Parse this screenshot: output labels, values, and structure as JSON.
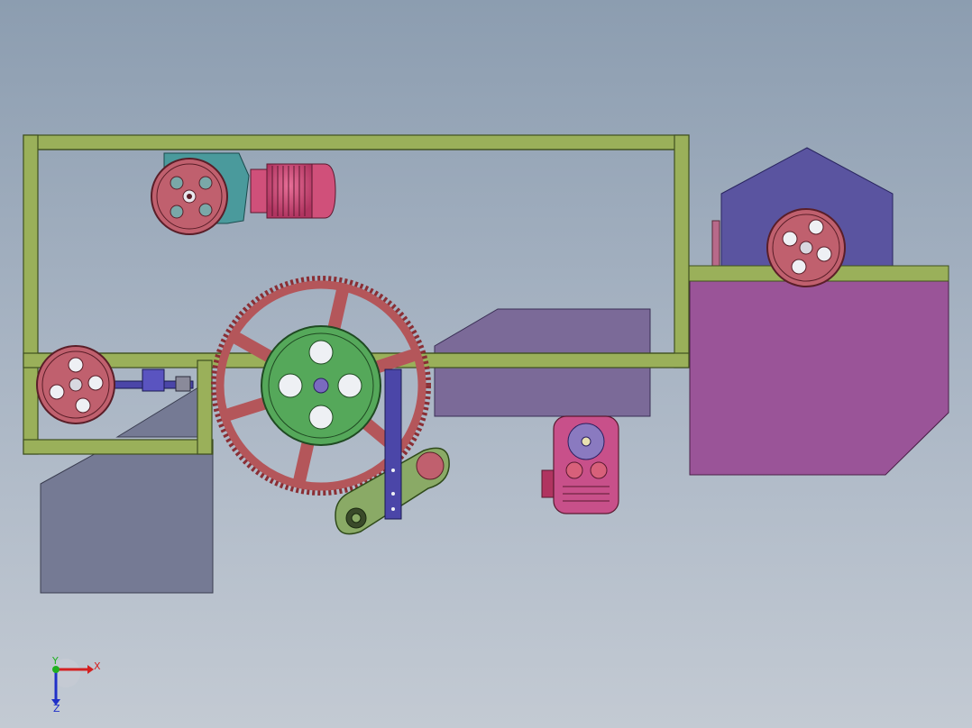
{
  "viewport": {
    "background_top": "#8c9db0",
    "background_bottom": "#c3cad3"
  },
  "colors": {
    "frame": "#9ab05a",
    "frame_edge": "#3f4f1f",
    "pulley": "#c0606e",
    "pulley_edge": "#5a1e28",
    "gear_wheel": "#b4565a",
    "drive_wheel": "#55a85a",
    "motor": "#d0507a",
    "gearbox": "#4a9a9c",
    "hopper": "#5a54a0",
    "table": "#9a5498",
    "tray": "#7b6a98",
    "chute": "#757a94",
    "tension_plate": "#8aaa66",
    "bracket": "#4b46a8"
  },
  "components": [
    "frame",
    "motor-reducer",
    "large-gear-wheel",
    "drive-wheel",
    "left-pulley",
    "right-pulley",
    "hopper",
    "work-table",
    "tray",
    "chute",
    "tension-arm",
    "bottom-motor"
  ],
  "triad": {
    "x_label": "X",
    "y_label": "Y",
    "z_label": "Z",
    "x_color": "#d42020",
    "y_color": "#20b020",
    "z_color": "#2030c8"
  }
}
